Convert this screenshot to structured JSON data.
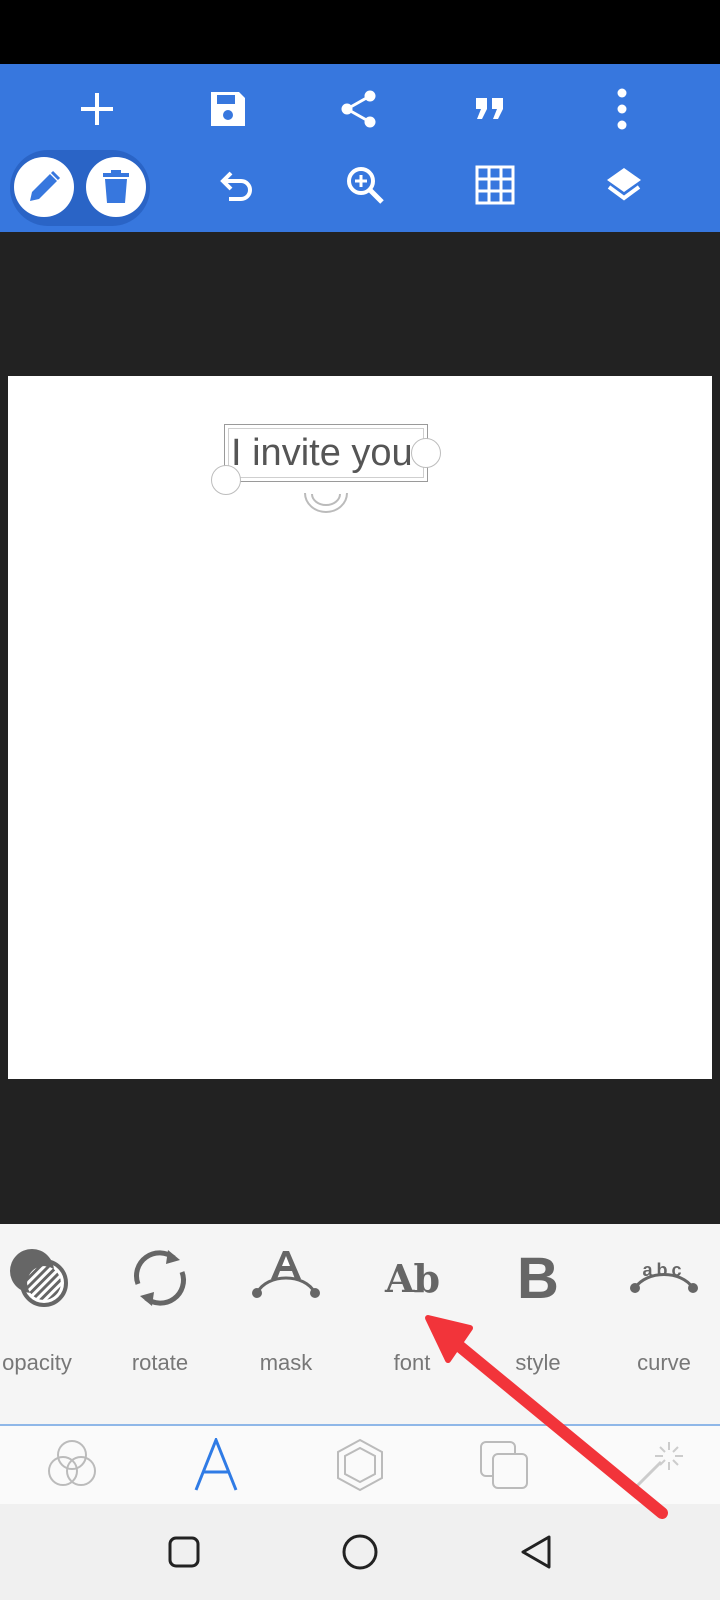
{
  "canvas": {
    "text": "I invite you"
  },
  "tools": [
    {
      "label": "opacity",
      "icon": "opacity-icon"
    },
    {
      "label": "rotate",
      "icon": "rotate-icon"
    },
    {
      "label": "mask",
      "icon": "mask-icon"
    },
    {
      "label": "font",
      "icon": "font-icon",
      "glyph": "Ab"
    },
    {
      "label": "style",
      "icon": "bold-icon",
      "glyph": "B"
    },
    {
      "label": "curve",
      "icon": "curve-icon",
      "glyph": "abc"
    }
  ],
  "colors": {
    "toolbar": "#3777DE",
    "accent": "#2F7BE5",
    "annotation": "#F2343A"
  }
}
